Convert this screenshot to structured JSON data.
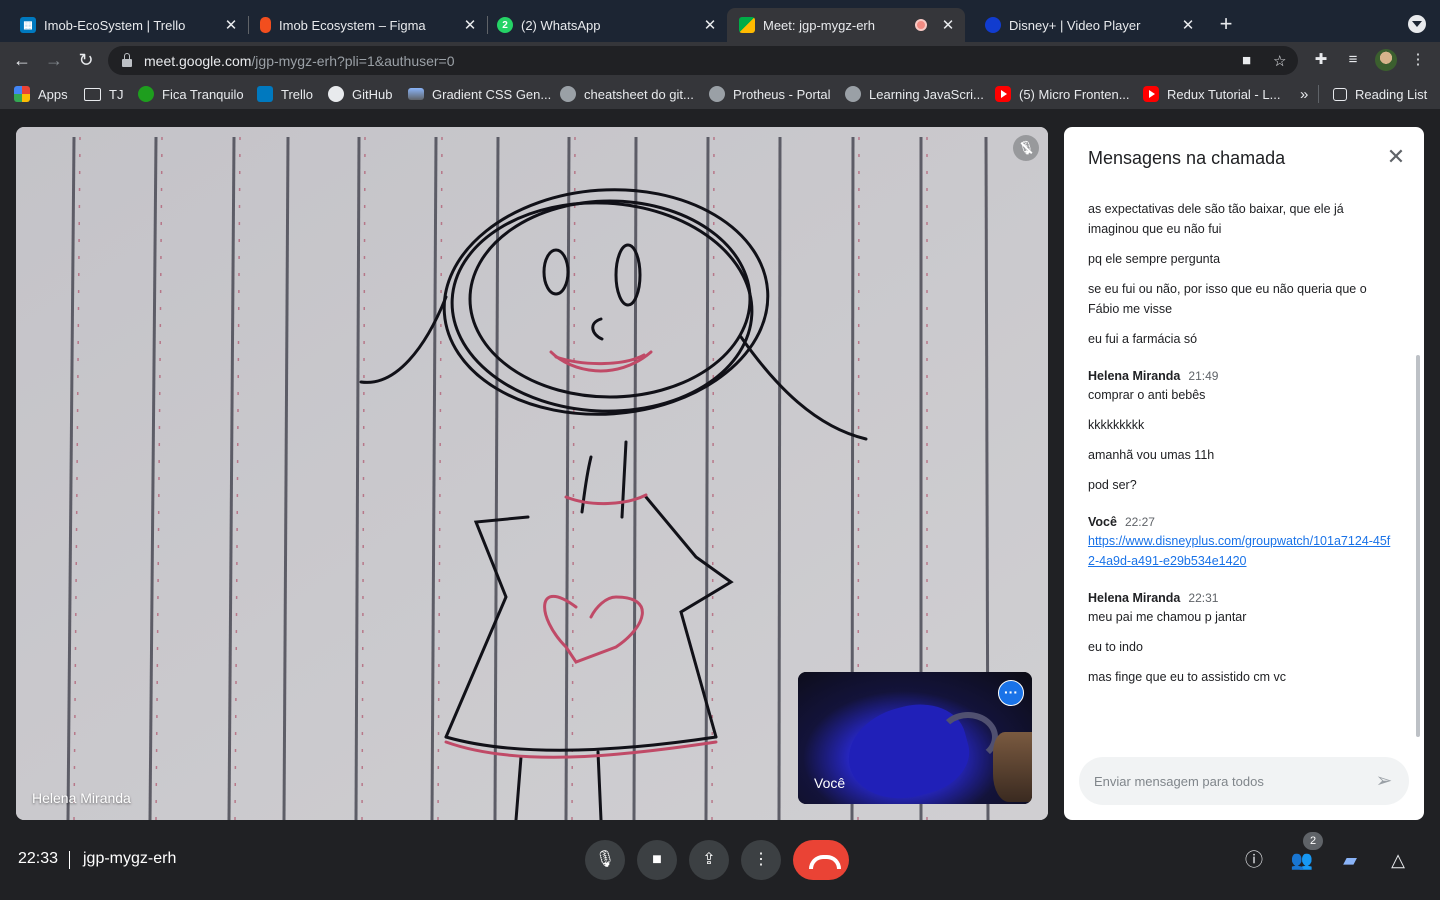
{
  "browser": {
    "tabs": [
      {
        "label": "Imob-EcoSystem | Trello",
        "icon": "trello-icon",
        "color": "#0079bf"
      },
      {
        "label": "Imob Ecosystem – Figma",
        "icon": "figma-icon",
        "color": "#f24e1e"
      },
      {
        "label": "(2) WhatsApp",
        "icon": "whatsapp-icon",
        "color": "#25d366",
        "badge": "2"
      },
      {
        "label": "Meet: jgp-mygz-erh",
        "icon": "meet-icon",
        "color": "#00832d",
        "active": true,
        "recording": true
      },
      {
        "label": "Disney+ | Video Player",
        "icon": "disney-icon",
        "color": "#113ccf"
      }
    ],
    "url_host": "meet.google.com",
    "url_path": "/jgp-mygz-erh?pli=1&authuser=0",
    "bookmarks": [
      {
        "label": "Apps",
        "icon": "apps-grid-icon"
      },
      {
        "label": "TJ",
        "icon": "folder-icon"
      },
      {
        "label": "Fica Tranquilo",
        "icon": "turtle-icon"
      },
      {
        "label": "Trello",
        "icon": "trello-icon"
      },
      {
        "label": "GitHub",
        "icon": "github-icon"
      },
      {
        "label": "Gradient CSS Gen...",
        "icon": "page-icon"
      },
      {
        "label": "cheatsheet do git...",
        "icon": "globe-icon"
      },
      {
        "label": "Protheus - Portal",
        "icon": "globe-icon"
      },
      {
        "label": "Learning JavaScri...",
        "icon": "globe-icon"
      },
      {
        "label": "(5) Micro Fronten...",
        "icon": "youtube-icon"
      },
      {
        "label": "Redux Tutorial - L...",
        "icon": "youtube-icon"
      }
    ],
    "more_bookmarks": "»",
    "reading_list": "Reading List"
  },
  "meet": {
    "main_participant": "Helena Miranda",
    "self_label": "Você",
    "clock": "22:33",
    "separator": "|",
    "meeting_code": "jgp-mygz-erh",
    "participants_count": "2"
  },
  "chat": {
    "title": "Mensagens na chamada",
    "first_messages": [
      "as expectativas dele são tão baixar, que ele já imaginou que eu não fui",
      "pq ele sempre pergunta",
      "se eu fui ou não, por isso que eu não queria que o Fábio me visse",
      "eu fui a farmácia só"
    ],
    "groups": [
      {
        "sender": "Helena Miranda",
        "time": "21:49",
        "messages": [
          "comprar o anti bebês",
          "kkkkkkkkk",
          "amanhã vou umas 11h",
          "pod ser?"
        ]
      },
      {
        "sender": "Você",
        "time": "22:27",
        "link": "https://www.disneyplus.com/groupwatch/101a7124-45f2-4a9d-a491-e29b534e1420"
      },
      {
        "sender": "Helena Miranda",
        "time": "22:31",
        "messages": [
          "meu pai me chamou p jantar",
          "eu to indo",
          "mas finge que eu to assistido cm vc"
        ]
      }
    ],
    "input_placeholder": "Enviar mensagem para todos"
  }
}
